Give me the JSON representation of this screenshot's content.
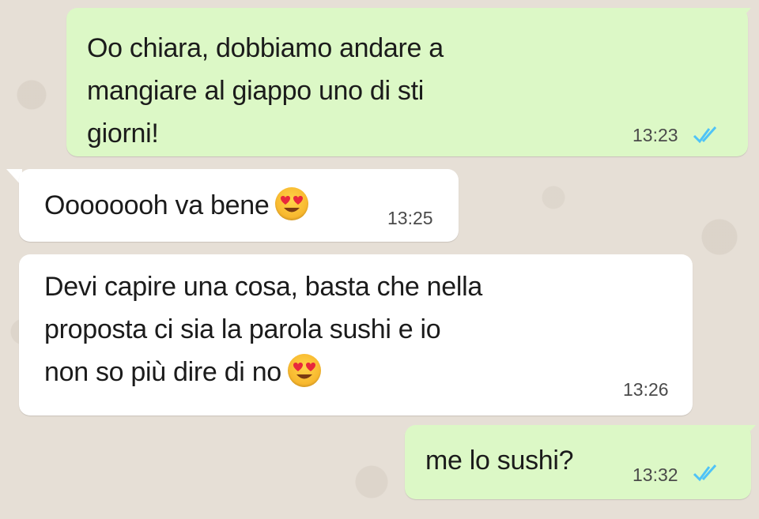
{
  "chat": {
    "messages": [
      {
        "id": "m1",
        "direction": "outgoing",
        "text": "Oo chiara, dobbiamo andare a\nmangiare al giappo uno di sti\ngiorni!",
        "time": "13:23",
        "status_icon": "double-check-read-icon",
        "emoji": null
      },
      {
        "id": "m2",
        "direction": "incoming",
        "text": "Oooooooh va bene",
        "time": "13:25",
        "emoji": "heart-eyes-emoji-icon"
      },
      {
        "id": "m3",
        "direction": "incoming",
        "text": "Devi capire una cosa, basta che nella\nproposta ci sia la parola sushi e io\nnon so più dire di no",
        "time": "13:26",
        "emoji": "heart-eyes-emoji-icon"
      },
      {
        "id": "m4",
        "direction": "outgoing",
        "text": "me lo sushi?",
        "time": "13:32",
        "status_icon": "double-check-read-icon",
        "emoji": null
      }
    ]
  },
  "colors": {
    "wallpaper": "#e6dfd6",
    "outgoing_bubble": "#dcf8c6",
    "incoming_bubble": "#ffffff",
    "read_ticks": "#4fc3f7"
  }
}
